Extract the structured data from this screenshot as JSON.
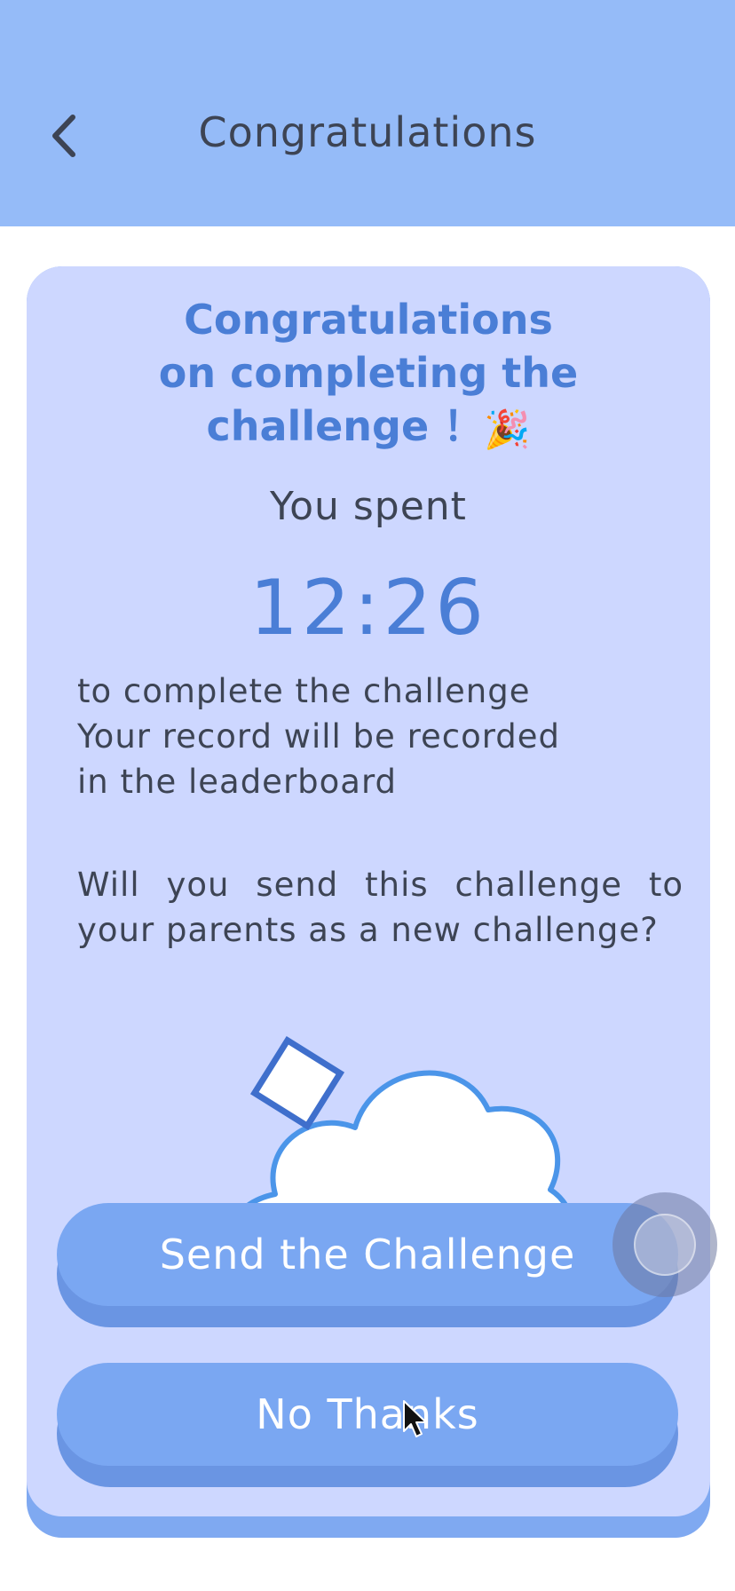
{
  "header": {
    "title": "Congratulations",
    "back_icon": "chevron-left-icon"
  },
  "card": {
    "headline_line1": "Congratulations",
    "headline_line2": "on completing the",
    "headline_line3": "challenge ！",
    "headline_icon": "🎉",
    "spent_label": "You spent",
    "time": "12:26",
    "record_line1": "to complete the challenge",
    "record_line2": "Your record will be recorded",
    "record_line3": "in the leaderboard",
    "question": "Will you send this challenge to your parents as a new challenge?",
    "mascot": "cloud-mascot-icon"
  },
  "actions": {
    "send_label": "Send the Challenge",
    "no_thanks_label": "No Thanks"
  },
  "colors": {
    "topbar": "#95bbf8",
    "card": "#cdd7ff",
    "accent": "#4a7ed6",
    "button": "#7aa7f2",
    "button_shadow": "#6a95e3",
    "text": "#3d4454"
  }
}
